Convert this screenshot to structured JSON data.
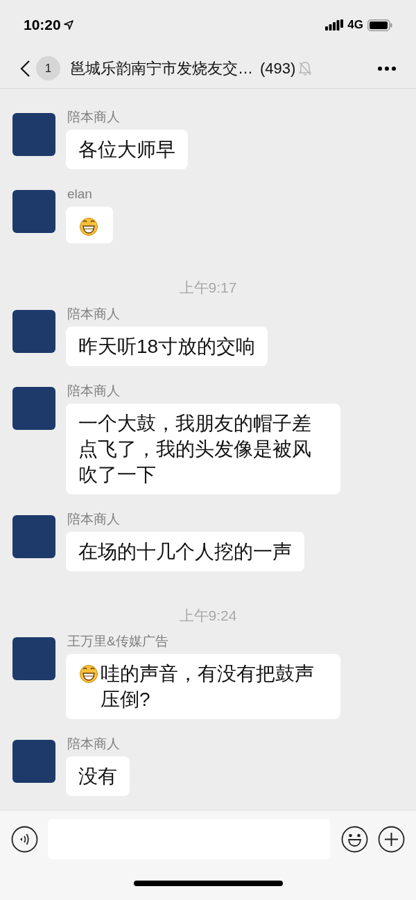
{
  "status_bar": {
    "time": "10:20",
    "network": "4G"
  },
  "header": {
    "unread_badge": "1",
    "title": "邕城乐韵南宁市发烧友交…",
    "member_count": "(493)",
    "muted": true
  },
  "messages": [
    {
      "kind": "message",
      "sender": "陪本商人",
      "parts": [
        {
          "kind": "text",
          "text": "各位大师早"
        }
      ]
    },
    {
      "kind": "message",
      "sender": "elan",
      "parts": [
        {
          "kind": "emoji"
        }
      ]
    },
    {
      "kind": "time",
      "text": "上午9:17"
    },
    {
      "kind": "message",
      "sender": "陪本商人",
      "parts": [
        {
          "kind": "text",
          "text": "昨天听18寸放的交响"
        }
      ]
    },
    {
      "kind": "message",
      "sender": "陪本商人",
      "parts": [
        {
          "kind": "text",
          "text": "一个大鼓，我朋友的帽子差点飞了，我的头发像是被风吹了一下"
        }
      ]
    },
    {
      "kind": "message",
      "sender": "陪本商人",
      "parts": [
        {
          "kind": "text",
          "text": "在场的十几个人挖的一声"
        }
      ]
    },
    {
      "kind": "time",
      "text": "上午9:24"
    },
    {
      "kind": "message",
      "sender": "王万里&传媒广告",
      "parts": [
        {
          "kind": "emoji"
        },
        {
          "kind": "text",
          "text": "哇的声音，有没有把鼓声压倒?"
        }
      ]
    },
    {
      "kind": "message",
      "sender": "陪本商人",
      "parts": [
        {
          "kind": "text",
          "text": "没有"
        }
      ]
    }
  ]
}
